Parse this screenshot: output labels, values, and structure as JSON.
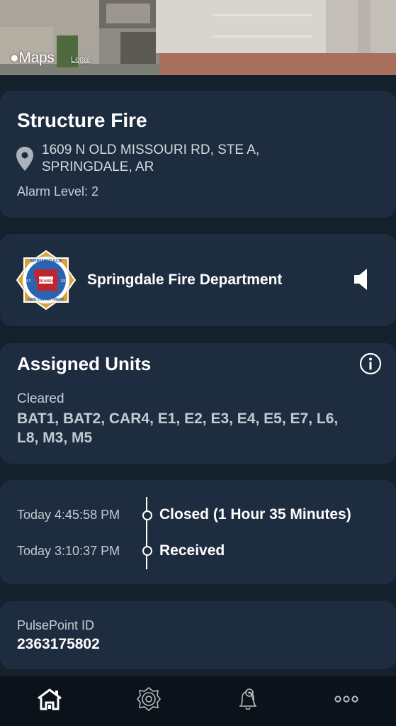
{
  "map": {
    "logo_text": "Maps",
    "legal_text": "Legal"
  },
  "incident": {
    "title": "Structure Fire",
    "address_line1": "1609 N OLD MISSOURI RD, STE A,",
    "address_line2": "SPRINGDALE, AR",
    "alarm_level": "Alarm Level: 2"
  },
  "agency": {
    "name": "Springdale Fire Department",
    "logo": {
      "arc_top": "SPRINGDALE",
      "arc_bottom": "FIRE DEPARTMENT",
      "est": "EST.",
      "year": "1909",
      "state_text": "ARKANSAS"
    }
  },
  "units": {
    "title": "Assigned Units",
    "status": "Cleared",
    "list_line1": "BAT1, BAT2, CAR4, E1, E2, E3, E4, E5, E7, L6,",
    "list_line2": "L8, M3, M5"
  },
  "timeline": [
    {
      "time": "Today 4:45:58 PM",
      "label": "Closed (1 Hour 35 Minutes)"
    },
    {
      "time": "Today 3:10:37 PM",
      "label": "Received"
    }
  ],
  "pulsepoint": {
    "label": "PulsePoint ID",
    "value": "2363175802"
  },
  "tabs": [
    "home-icon",
    "fire-badge-icon",
    "alert-settings-icon",
    "more-icon"
  ],
  "colors": {
    "background": "#14202c",
    "card": "#1d2d3f",
    "tabbar": "#0c1219"
  }
}
